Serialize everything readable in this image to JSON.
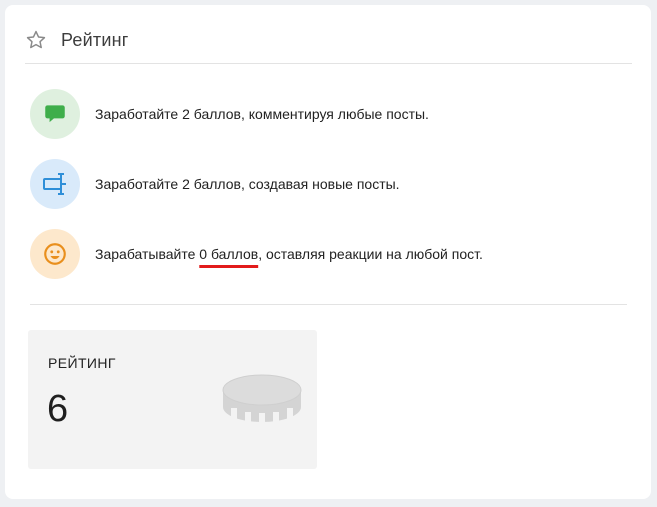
{
  "rating_card": {
    "title": "Рейтинг",
    "title_icon": "star-outline-icon",
    "tips": [
      {
        "icon": "comment-bubble-icon",
        "icon_color": "#3fae4b",
        "circle_color": "#dff0df",
        "text": "Заработайте 2 баллов, комментируя любые посты."
      },
      {
        "icon": "new-post-icon",
        "icon_color": "#2f8fd8",
        "circle_color": "#d9eafa",
        "text": "Заработайте 2 баллов, создавая новые посты."
      },
      {
        "icon": "smiley-icon",
        "icon_color": "#e98f1d",
        "circle_color": "#fde8cc",
        "text_before": "Зарабатывайте ",
        "text_highlight": "0 баллов",
        "text_after": ", оставляя реакции на любой пост."
      }
    ],
    "rating": {
      "label": "РЕЙТИНГ",
      "value": "6",
      "icon": "coin-stack-icon"
    }
  }
}
